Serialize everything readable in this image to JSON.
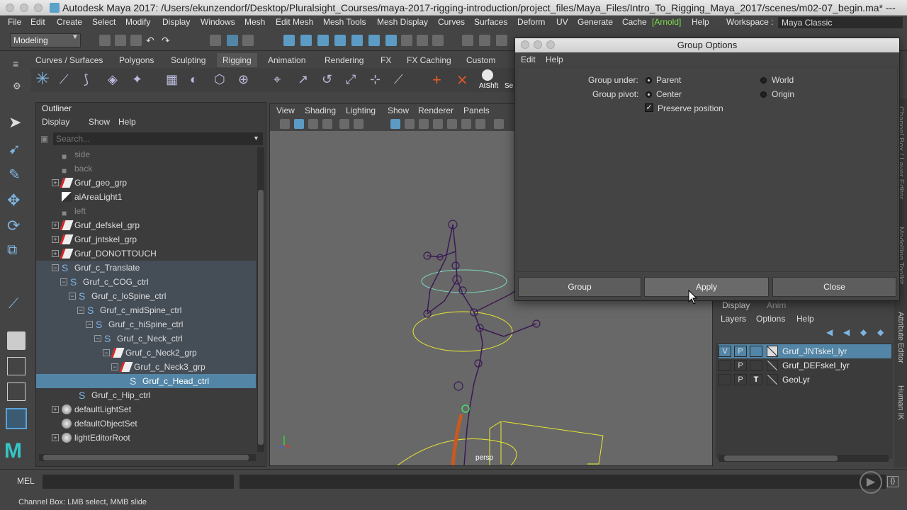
{
  "title": "Autodesk Maya 2017: /Users/ekunzendorf/Desktop/Pluralsight_Courses/maya-2017-rigging-introduction/project_files/Maya_Files/Intro_To_Rigging_Maya_2017/scenes/m02-07_begin.ma* ---",
  "menu": [
    "File",
    "Edit",
    "Create",
    "Select",
    "Modify",
    "Display",
    "Windows",
    "Mesh",
    "Edit Mesh",
    "Mesh Tools",
    "Mesh Display",
    "Curves",
    "Surfaces",
    "Deform",
    "UV",
    "Generate",
    "Cache",
    "[Arnold]",
    "Help"
  ],
  "workspace": {
    "label": "Workspace :",
    "value": "Maya Classic"
  },
  "mode": "Modeling",
  "shelf_tabs": [
    "Curves / Surfaces",
    "Polygons",
    "Sculpting",
    "Rigging",
    "Animation",
    "Rendering",
    "FX",
    "FX Caching",
    "Custom"
  ],
  "shelf_extra": [
    "AtShft",
    "Se"
  ],
  "outliner": {
    "title": "Outliner",
    "menu": [
      "Display",
      "Show",
      "Help"
    ],
    "search_placeholder": "Search...",
    "rows": [
      {
        "label": "side"
      },
      {
        "label": "back"
      },
      {
        "label": "Gruf_geo_grp"
      },
      {
        "label": "aiAreaLight1"
      },
      {
        "label": "left"
      },
      {
        "label": "Gruf_defskel_grp"
      },
      {
        "label": "Gruf_jntskel_grp"
      },
      {
        "label": "Gruf_DONOTTOUCH"
      },
      {
        "label": "Gruf_c_Translate"
      },
      {
        "label": "Gruf_c_COG_ctrl"
      },
      {
        "label": "Gruf_c_loSpine_ctrl"
      },
      {
        "label": "Gruf_c_midSpine_ctrl"
      },
      {
        "label": "Gruf_c_hiSpine_ctrl"
      },
      {
        "label": "Gruf_c_Neck_ctrl"
      },
      {
        "label": "Gruf_c_Neck2_grp"
      },
      {
        "label": "Gruf_c_Neck3_grp"
      },
      {
        "label": "Gruf_c_Head_ctrl"
      },
      {
        "label": "Gruf_c_Hip_ctrl"
      },
      {
        "label": "defaultLightSet"
      },
      {
        "label": "defaultObjectSet"
      },
      {
        "label": "lightEditorRoot"
      }
    ]
  },
  "viewport": {
    "menu": [
      "View",
      "Shading",
      "Lighting",
      "Show",
      "Renderer",
      "Panels"
    ],
    "camera": "persp"
  },
  "dialog": {
    "title": "Group Options",
    "menu": [
      "Edit",
      "Help"
    ],
    "group_under_label": "Group under:",
    "group_under_options": [
      "Parent",
      "World"
    ],
    "group_pivot_label": "Group pivot:",
    "group_pivot_options": [
      "Center",
      "Origin"
    ],
    "preserve_label": "Preserve position",
    "buttons": [
      "Group",
      "Apply",
      "Close"
    ]
  },
  "layers": {
    "tabs": [
      "Display",
      "Anim"
    ],
    "menu": [
      "Layers",
      "Options",
      "Help"
    ],
    "rows": [
      {
        "v": "V",
        "p": "P",
        "t": "",
        "name": "Gruf_JNTskel_lyr"
      },
      {
        "v": "",
        "p": "P",
        "t": "",
        "name": "Gruf_DEFskel_lyr"
      },
      {
        "v": "",
        "p": "P",
        "t": "T",
        "name": "GeoLyr"
      }
    ]
  },
  "side_tabs": [
    "Attribute Editor",
    "Human IK",
    "Channel Box / Layer Editor",
    "Modelling Toolkit"
  ],
  "cmd_label": "MEL",
  "help_line": "Channel Box: LMB select, MMB slide",
  "colors": {
    "selection": "#5285a6",
    "wire": "#3a1a55",
    "ctrl": "#e8e832",
    "ctrl_alt": "#7fdbbf"
  }
}
